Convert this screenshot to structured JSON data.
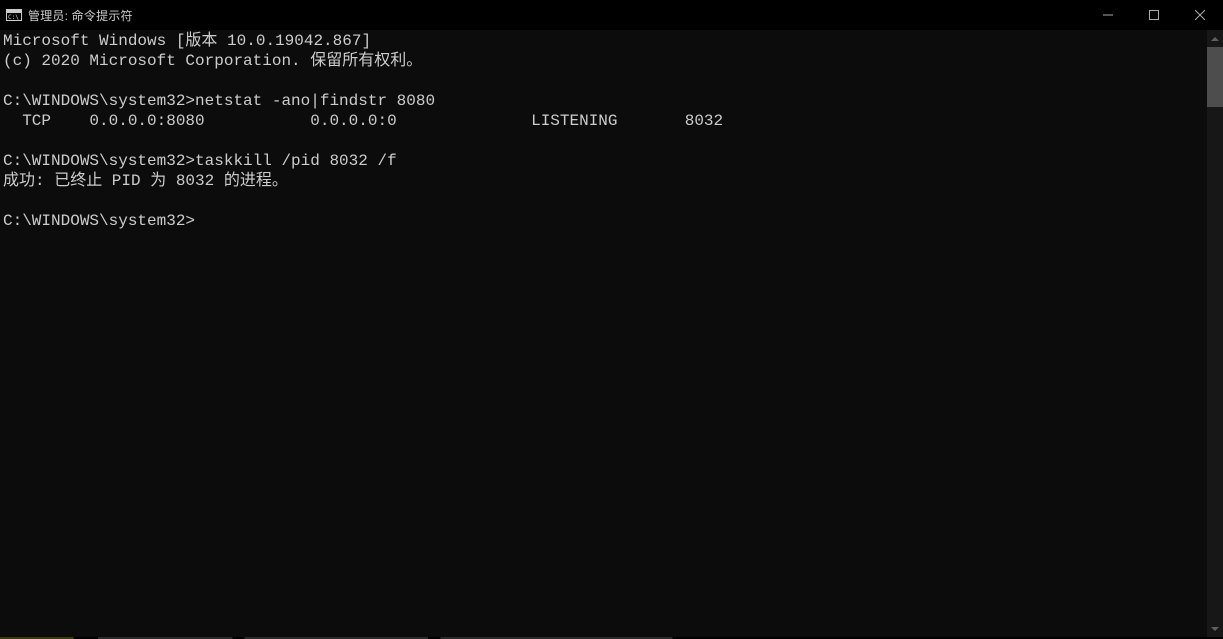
{
  "titlebar": {
    "title": "管理员: 命令提示符"
  },
  "terminal": {
    "lines": {
      "l0": "Microsoft Windows [版本 10.0.19042.867]",
      "l1": "(c) 2020 Microsoft Corporation. 保留所有权利。",
      "l2": "",
      "l3": "C:\\WINDOWS\\system32>netstat -ano|findstr 8080",
      "l4": "  TCP    0.0.0.0:8080           0.0.0.0:0              LISTENING       8032",
      "l5": "",
      "l6": "C:\\WINDOWS\\system32>taskkill /pid 8032 /f",
      "l7": "成功: 已终止 PID 为 8032 的进程。",
      "l8": "",
      "l9": "C:\\WINDOWS\\system32>"
    }
  }
}
